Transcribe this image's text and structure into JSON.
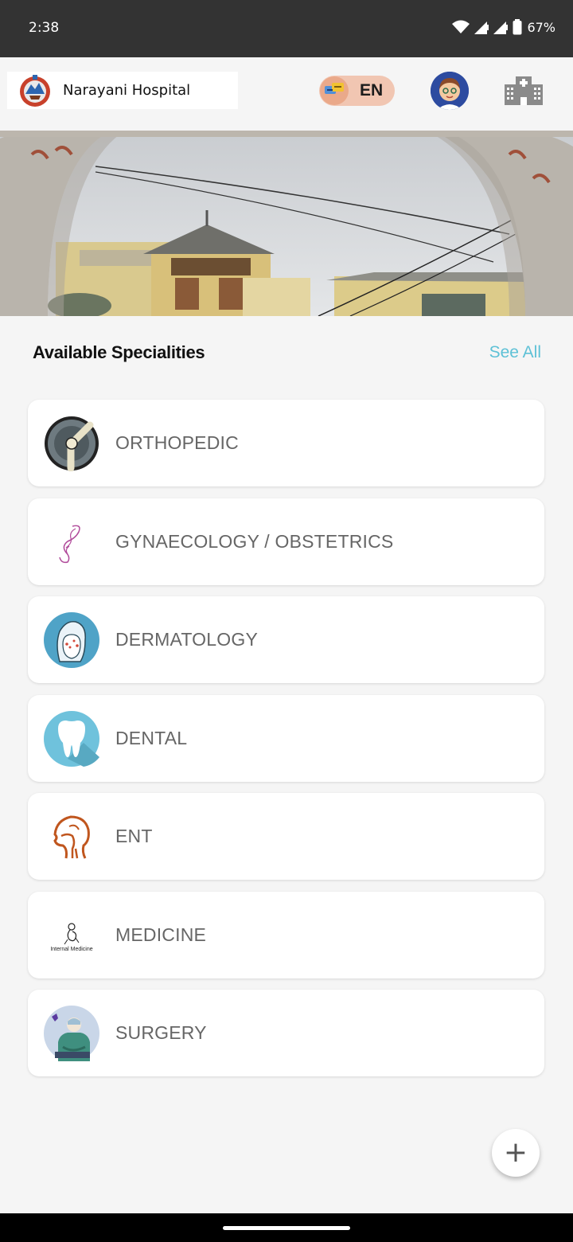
{
  "status_bar": {
    "time": "2:38",
    "battery": "67%",
    "icons": [
      "wifi-icon",
      "signal-icon",
      "signal-icon",
      "battery-icon"
    ]
  },
  "header": {
    "brand_name": "Narayani Hospital",
    "language": "EN",
    "icons": [
      "hospital-logo-icon",
      "language-chat-icon",
      "doctor-avatar-icon",
      "hospital-building-icon"
    ]
  },
  "specialities": {
    "title": "Available Specialities",
    "see_all": "See All",
    "items": [
      {
        "label": "ORTHOPEDIC",
        "icon": "bone-joint-icon"
      },
      {
        "label": "GYNAECOLOGY / OBSTETRICS",
        "icon": "uterus-icon"
      },
      {
        "label": "DERMATOLOGY",
        "icon": "face-skin-icon"
      },
      {
        "label": "DENTAL",
        "icon": "tooth-icon"
      },
      {
        "label": "ENT",
        "icon": "head-throat-icon"
      },
      {
        "label": "MEDICINE",
        "icon": "internal-medicine-icon",
        "icon_caption": "Internal Medicine"
      },
      {
        "label": "SURGERY",
        "icon": "surgeon-icon"
      }
    ]
  },
  "fab": {
    "label": "+"
  },
  "colors": {
    "accent": "#5ec1d6",
    "status_bar": "#333333",
    "background": "#f5f5f5",
    "lang_toggle": "#f1c6b2"
  }
}
